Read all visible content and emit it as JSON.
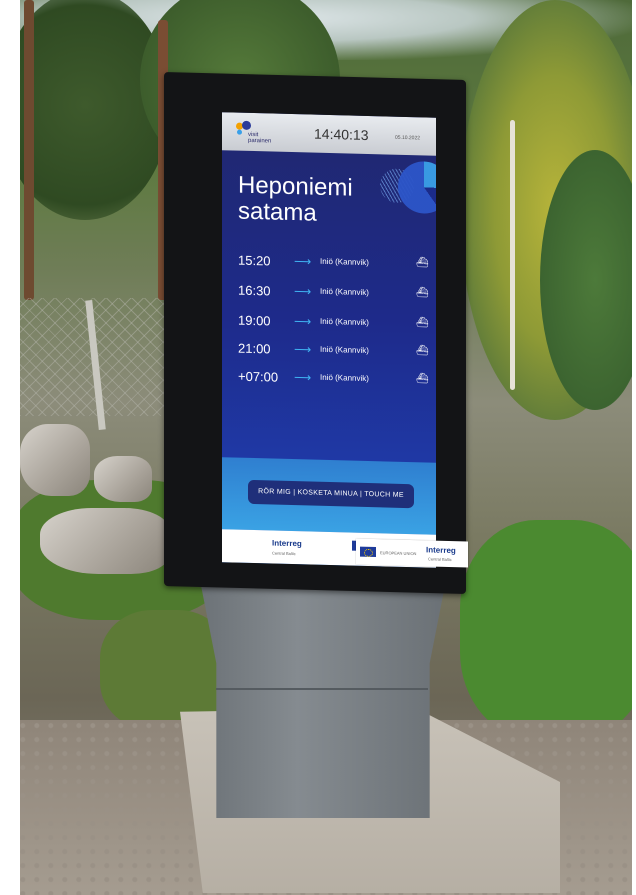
{
  "kiosk": {
    "logo_text": "visit parainen",
    "clock": "14:40:13",
    "date": "05.10.2022",
    "stop_name": "Heponiemi satama",
    "departures": [
      {
        "time": "15:20",
        "destination": "Iniö (Kannvik)",
        "icon": "ferry-icon"
      },
      {
        "time": "16:30",
        "destination": "Iniö (Kannvik)",
        "icon": "ferry-icon"
      },
      {
        "time": "19:00",
        "destination": "Iniö (Kannvik)",
        "icon": "ferry-icon"
      },
      {
        "time": "21:00",
        "destination": "Iniö (Kannvik)",
        "icon": "ferry-icon"
      },
      {
        "time": "+07:00",
        "destination": "Iniö (Kannvik)",
        "icon": "ferry-icon"
      }
    ],
    "touch_label": "RÖR MIG | KOSKETA MINUA | TOUCH ME",
    "footer": {
      "interreg": "Interreg",
      "interreg_sub": "Central Baltic",
      "eu_text": "EUROPEAN UNION"
    },
    "sticker": {
      "eu_text": "EUROPEAN UNION",
      "interreg": "Interreg",
      "interreg_sub": "Central Baltic"
    },
    "colors": {
      "screen_dark": "#1e2a8a",
      "screen_light": "#3aa2e4",
      "arrow": "#3fb2f2",
      "button": "#1f2f7a"
    }
  }
}
